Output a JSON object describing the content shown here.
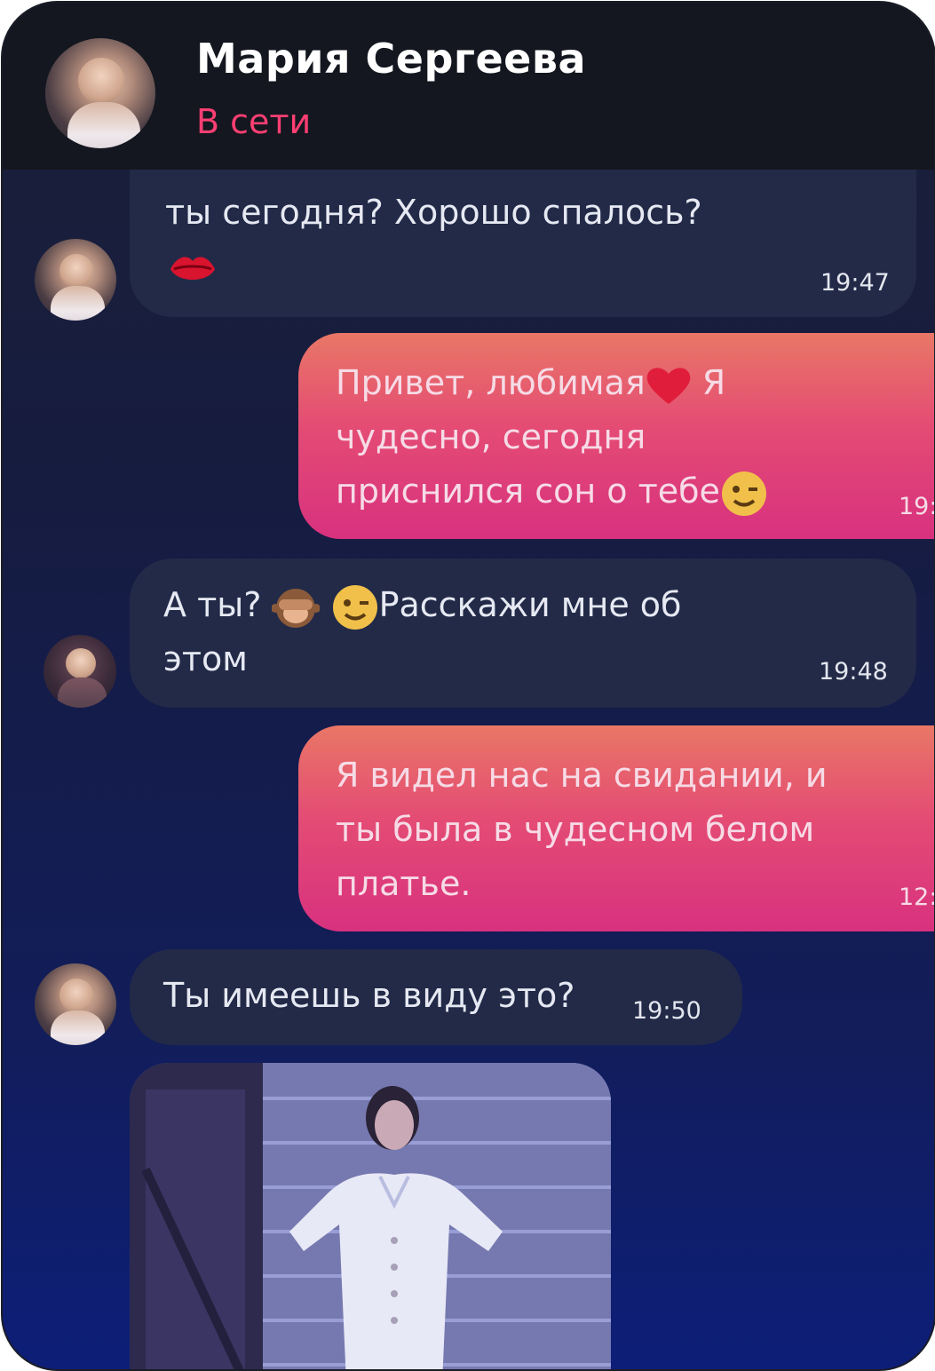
{
  "header": {
    "contact_name": "Мария Сергеева",
    "status": "В сети"
  },
  "messages": [
    {
      "direction": "incoming",
      "text": "ты сегодня? Хорошо спалось?",
      "emoji": "kiss-lips",
      "time": "19:47"
    },
    {
      "direction": "outgoing",
      "line1": "Привет, любимая",
      "line1_tail": "Я",
      "line2": "чудесно, сегодня",
      "line3": "приснился сон о тебе",
      "time": "19:"
    },
    {
      "direction": "incoming",
      "prefix": "А ты?",
      "line1": "Расскажи мне об",
      "line2": "этом",
      "time": "19:48"
    },
    {
      "direction": "outgoing",
      "line1": "Я видел нас на свидании, и",
      "line2": "ты была в чудесном белом",
      "line3": "платье.",
      "time": "12:"
    },
    {
      "direction": "incoming",
      "text": "Ты имеешь в виду это?",
      "time": "19:50"
    }
  ],
  "icons": [
    "kiss-lips-icon",
    "heart-icon",
    "winking-face-icon",
    "see-no-evil-monkey-icon"
  ],
  "colors": {
    "header_bg": "#14171f",
    "status_online": "#ff3f73",
    "incoming_bubble": "#222a48",
    "outgoing_gradient_top": "#e97766",
    "outgoing_gradient_bottom": "#d8317f"
  }
}
